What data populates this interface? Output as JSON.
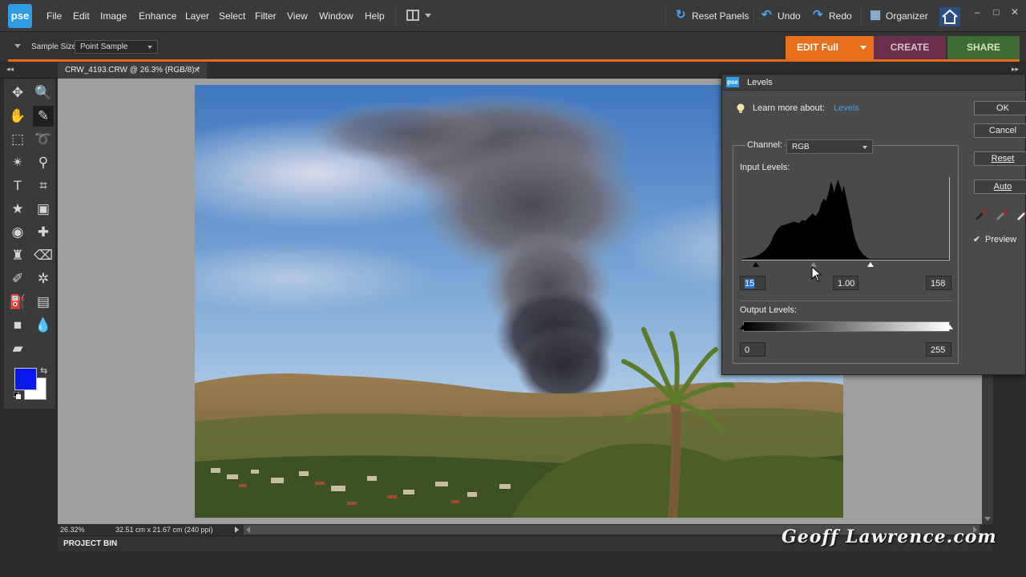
{
  "app": {
    "logo": "pse",
    "menu": [
      "File",
      "Edit",
      "Image",
      "Enhance",
      "Layer",
      "Select",
      "Filter",
      "View",
      "Window",
      "Help"
    ],
    "reset_panels": "Reset Panels",
    "undo": "Undo",
    "redo": "Redo",
    "organizer": "Organizer",
    "accent_color": "#e8691c"
  },
  "options": {
    "sample_size_label": "Sample Size:",
    "sample_size_value": "Point Sample"
  },
  "modes": {
    "edit": "EDIT Full",
    "create": "CREATE",
    "share": "SHARE"
  },
  "document": {
    "tab_title": "CRW_4193.CRW @ 26.3% (RGB/8) *",
    "close_glyph": "✕"
  },
  "tools": [
    {
      "name": "move-tool-icon",
      "glyph": "✥"
    },
    {
      "name": "zoom-tool-icon",
      "glyph": "🔍"
    },
    {
      "name": "hand-tool-icon",
      "glyph": "✋"
    },
    {
      "name": "eyedropper-tool-icon",
      "glyph": "✎",
      "active": true
    },
    {
      "name": "marquee-tool-icon",
      "glyph": "⬚"
    },
    {
      "name": "lasso-tool-icon",
      "glyph": "➰"
    },
    {
      "name": "magic-wand-tool-icon",
      "glyph": "✴"
    },
    {
      "name": "quick-selection-tool-icon",
      "glyph": "⚲"
    },
    {
      "name": "type-tool-icon",
      "glyph": "T"
    },
    {
      "name": "crop-tool-icon",
      "glyph": "⌗"
    },
    {
      "name": "cookie-cutter-tool-icon",
      "glyph": "★"
    },
    {
      "name": "straighten-tool-icon",
      "glyph": "▣"
    },
    {
      "name": "red-eye-tool-icon",
      "glyph": "◉"
    },
    {
      "name": "spot-healing-tool-icon",
      "glyph": "✚"
    },
    {
      "name": "clone-stamp-tool-icon",
      "glyph": "♜"
    },
    {
      "name": "eraser-tool-icon",
      "glyph": "⌫"
    },
    {
      "name": "brush-tool-icon",
      "glyph": "✐"
    },
    {
      "name": "smart-brush-tool-icon",
      "glyph": "✲"
    },
    {
      "name": "paint-bucket-tool-icon",
      "glyph": "⛽"
    },
    {
      "name": "gradient-tool-icon",
      "glyph": "▤"
    },
    {
      "name": "shape-tool-icon",
      "glyph": "■"
    },
    {
      "name": "blur-tool-icon",
      "glyph": "💧"
    },
    {
      "name": "sponge-tool-icon",
      "glyph": "▰"
    }
  ],
  "colors": {
    "foreground": "#0a18f0",
    "background": "#ffffff"
  },
  "status": {
    "zoom": "26.32%",
    "doc_size": "32.51 cm x 21.67 cm (240 ppi)"
  },
  "project_bin": "PROJECT BIN",
  "watermark": "Geoff Lawrence.com",
  "levels": {
    "title": "Levels",
    "learn_more": "Learn more about:",
    "learn_link": "Levels",
    "channel_label": "Channel:",
    "channel_value": "RGB",
    "input_label": "Input Levels:",
    "input_black": "15",
    "input_gamma": "1.00",
    "input_white": "158",
    "output_label": "Output Levels:",
    "output_black": "0",
    "output_white": "255",
    "ok": "OK",
    "cancel": "Cancel",
    "reset": "Reset",
    "auto": "Auto",
    "preview_label": "Preview",
    "preview_checked": true
  }
}
